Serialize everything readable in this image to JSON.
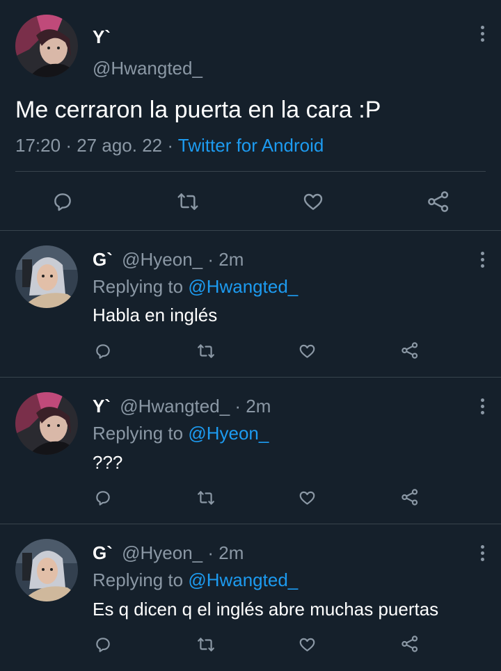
{
  "main_tweet": {
    "display_name": "Y`",
    "handle": "@Hwangted_",
    "text": "Me cerraron la puerta en la cara :P",
    "time": "17:20",
    "sep1": "·",
    "date": "27 ago. 22",
    "sep2": "·",
    "source": "Twitter for Android"
  },
  "replies": [
    {
      "display_name": "G`",
      "handle": "@Hyeon_",
      "time": "· 2m",
      "replying_prefix": "Replying to",
      "replying_to": "@Hwangted_",
      "text": "Habla en inglés"
    },
    {
      "display_name": "Y`",
      "handle": "@Hwangted_",
      "time": "· 2m",
      "replying_prefix": "Replying to",
      "replying_to": "@Hyeon_",
      "text": "???"
    },
    {
      "display_name": "G`",
      "handle": "@Hyeon_",
      "time": "· 2m",
      "replying_prefix": "Replying to",
      "replying_to": "@Hwangted_",
      "text": "Es q dicen q el inglés abre muchas puertas"
    }
  ],
  "icons": [
    "comment-icon",
    "retweet-icon",
    "like-icon",
    "share-icon",
    "more-options-icon"
  ],
  "colors": {
    "background": "#15202b",
    "text": "#ffffff",
    "secondary": "#8b98a5",
    "link": "#1d9bf0",
    "divider": "#38444d"
  }
}
